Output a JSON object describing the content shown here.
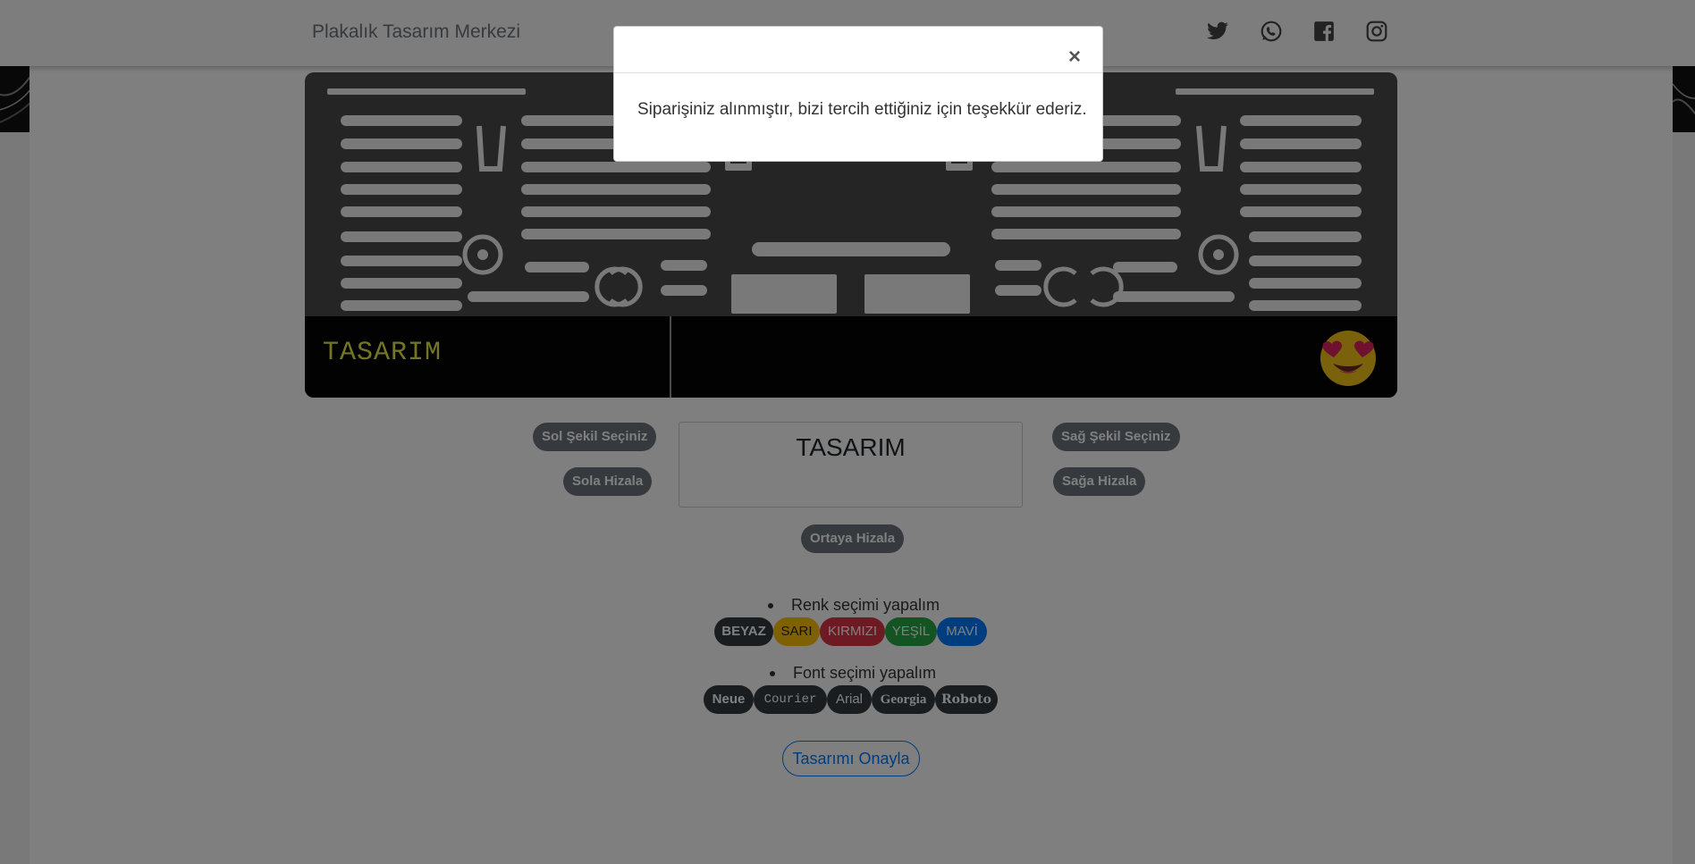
{
  "header": {
    "brand": "Plakalık Tasarım Merkezi",
    "social": [
      "twitter-icon",
      "whatsapp-icon",
      "facebook-icon",
      "instagram-icon"
    ]
  },
  "plate": {
    "text": "TASARIM",
    "text_color": "#e8e84a",
    "emoji": "heart-eyes-emoji-icon"
  },
  "controls": {
    "left_shape": "Sol Şekil Seçiniz",
    "align_left": "Sola Hizala",
    "text_value": "TASARIM",
    "right_shape": "Sağ Şekil Seçiniz",
    "align_right": "Sağa Hizala",
    "align_center": "Ortaya Hizala"
  },
  "colors": {
    "label": "Renk seçimi yapalım",
    "options": [
      {
        "label": "BEYAZ",
        "color": "#343a40"
      },
      {
        "label": "SARI",
        "color": "#ffc107"
      },
      {
        "label": "KIRMIZI",
        "color": "#dc3545"
      },
      {
        "label": "YEŞİL",
        "color": "#28a745"
      },
      {
        "label": "MAVİ",
        "color": "#007bff"
      }
    ]
  },
  "fonts": {
    "label": "Font seçimi yapalım",
    "options": [
      "Neue",
      "Courier",
      "Arial",
      "Georgia",
      "Roboto"
    ]
  },
  "confirm": "Tasarımı Onayla",
  "modal": {
    "close": "×",
    "message": "Siparişiniz alınmıştır, bizi tercih ettiğiniz için teşekkür ederiz."
  }
}
